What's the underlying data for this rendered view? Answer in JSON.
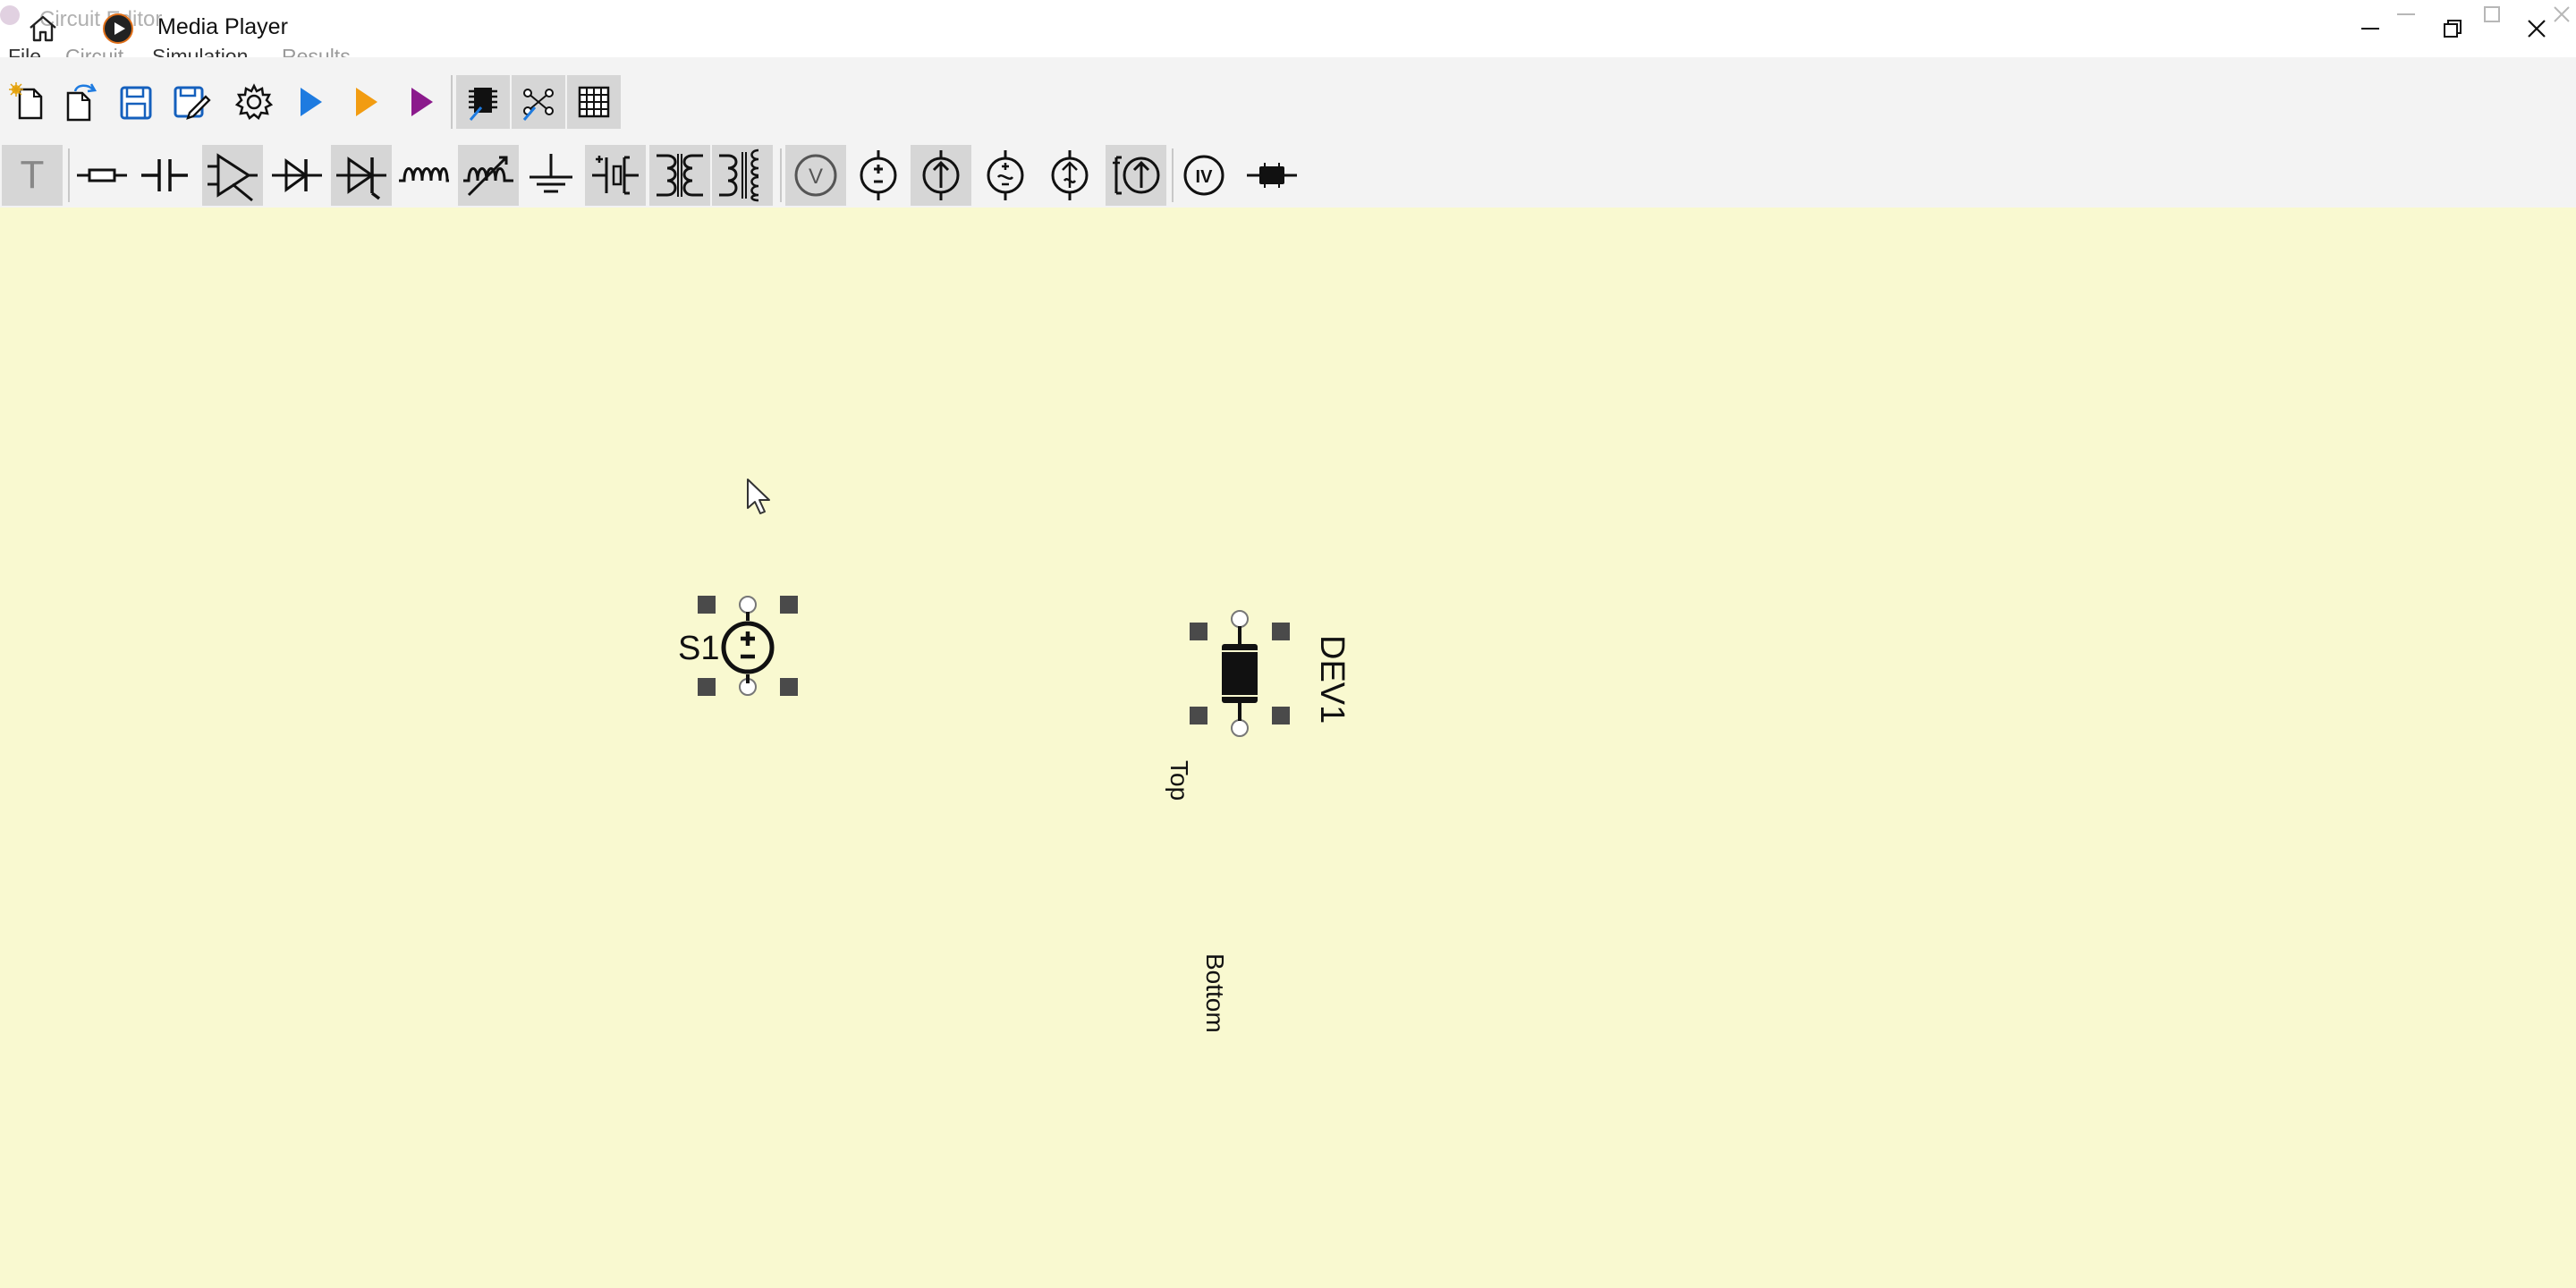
{
  "window": {
    "background_title": "Circuit Editor",
    "title": "Media Player"
  },
  "menu": {
    "items": [
      "File",
      "Circuit",
      "Simulation",
      "Results"
    ]
  },
  "toolbar_main": [
    {
      "name": "new-file-icon"
    },
    {
      "name": "open-file-icon"
    },
    {
      "name": "save-icon"
    },
    {
      "name": "save-as-icon"
    },
    {
      "name": "settings-gear-icon"
    },
    {
      "name": "run-blue-icon",
      "color": "#1e7be0"
    },
    {
      "name": "run-orange-icon",
      "color": "#f29c11"
    },
    {
      "name": "run-purple-icon",
      "color": "#8b1a8c"
    },
    {
      "name": "chip-probe-icon"
    },
    {
      "name": "network-probe-icon"
    },
    {
      "name": "table-grid-icon"
    }
  ],
  "toolbar_components": [
    {
      "name": "text-tool-icon",
      "glyph": "T"
    },
    {
      "name": "resistor-icon"
    },
    {
      "name": "capacitor-icon"
    },
    {
      "name": "opamp-icon"
    },
    {
      "name": "diode-icon"
    },
    {
      "name": "zener-diode-icon"
    },
    {
      "name": "inductor-icon"
    },
    {
      "name": "variable-inductor-icon"
    },
    {
      "name": "ground-icon"
    },
    {
      "name": "polarized-capacitor-icon"
    },
    {
      "name": "transformer-icon"
    },
    {
      "name": "three-winding-transformer-icon"
    },
    {
      "name": "voltmeter-icon",
      "glyph": "V"
    },
    {
      "name": "dc-voltage-source-icon"
    },
    {
      "name": "current-source-icon"
    },
    {
      "name": "ac-voltage-source-icon"
    },
    {
      "name": "controlled-current-source-icon"
    },
    {
      "name": "dependent-source-icon"
    },
    {
      "name": "iv-meter-icon",
      "glyph": "IV"
    },
    {
      "name": "device-block-icon"
    }
  ],
  "canvas": {
    "background": "#f9f9d0",
    "components": [
      {
        "id": "S1",
        "label": "S1",
        "type": "dc-voltage-source",
        "selected": true
      },
      {
        "id": "DEV1",
        "label": "DEV1",
        "type": "device",
        "selected": true,
        "pins": [
          "Top",
          "Bottom"
        ]
      }
    ]
  }
}
